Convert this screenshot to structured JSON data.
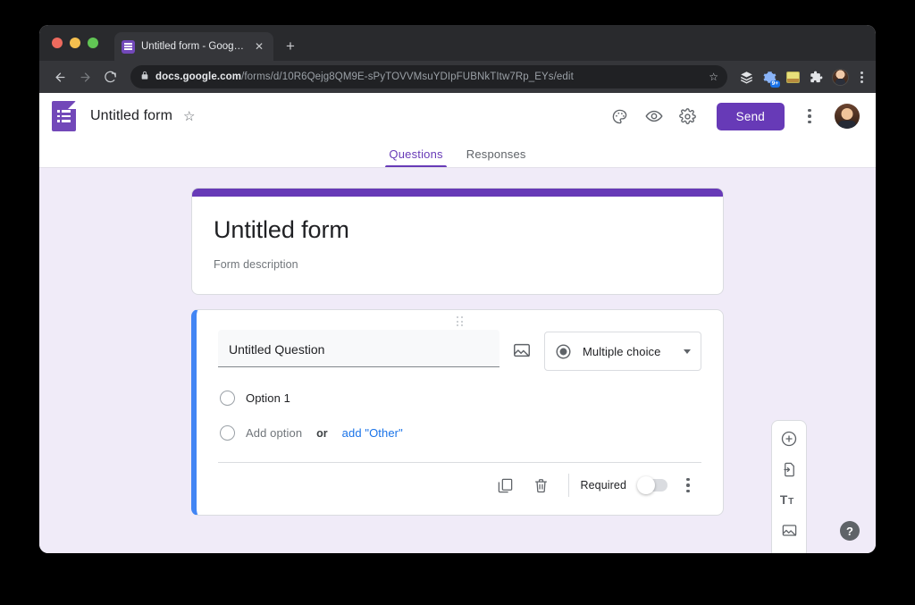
{
  "browser": {
    "tab": {
      "title": "Untitled form - Google Forms",
      "favicon": "google-forms-favicon",
      "close": "✕"
    },
    "new_tab": "+",
    "nav": {
      "back": "back-arrow-icon",
      "forward": "forward-arrow-icon",
      "reload": "reload-icon"
    },
    "omnibox": {
      "lock": "lock-icon",
      "url_domain": "docs.google.com",
      "url_path": "/forms/d/10R6Qejg8QM9E-sPyTOVVMsuYDIpFUBNkTItw7Rp_EYs/edit",
      "bookmark_star": "☆"
    },
    "extensions": [
      {
        "name": "stack-extension-icon",
        "badge": ""
      },
      {
        "name": "gear-extension-icon",
        "badge": "9+"
      },
      {
        "name": "sticky-note-extension-icon",
        "badge": ""
      },
      {
        "name": "puzzle-extensions-icon",
        "badge": ""
      }
    ],
    "profile": "profile-avatar",
    "menu": "chrome-menu-icon"
  },
  "app": {
    "logo": "google-forms-logo",
    "title": "Untitled form",
    "star": "☆",
    "actions": {
      "theme": "palette-icon",
      "preview": "eye-icon",
      "settings": "gear-icon",
      "send_label": "Send",
      "more": "more-options-icon",
      "account": "account-avatar"
    },
    "tabs": [
      {
        "label": "Questions",
        "active": true
      },
      {
        "label": "Responses",
        "active": false
      }
    ],
    "accent_color": "#673ab7",
    "background_color": "#f0ebf8",
    "question_accent_color": "#4285f4"
  },
  "form": {
    "title": "Untitled form",
    "description": "Form description",
    "question": {
      "drag_handle": "drag-handle-icon",
      "text": "Untitled Question",
      "image_button": "add-image-icon",
      "type": {
        "icon": "radio-button-icon",
        "label": "Multiple choice",
        "caret": "chevron-down-icon"
      },
      "options": [
        {
          "label": "Option 1"
        }
      ],
      "add_option_label": "Add option",
      "or_label": "or",
      "add_other_label": "add \"Other\"",
      "footer": {
        "duplicate": "duplicate-icon",
        "delete": "trash-icon",
        "required_label": "Required",
        "required_on": false,
        "more": "more-options-icon"
      }
    }
  },
  "side_toolbar": [
    {
      "name": "add-question-icon"
    },
    {
      "name": "import-questions-icon"
    },
    {
      "name": "add-title-description-icon"
    },
    {
      "name": "add-image-icon"
    },
    {
      "name": "add-video-icon"
    },
    {
      "name": "add-section-icon"
    }
  ],
  "help": {
    "label": "?"
  }
}
